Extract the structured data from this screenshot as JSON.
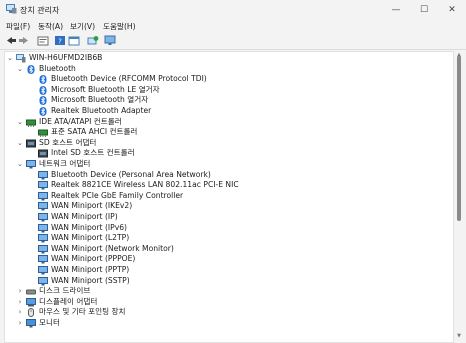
{
  "window": {
    "title": "장치 관리자",
    "minimize": "—",
    "maximize": "☐",
    "close": "✕"
  },
  "menu": [
    "파일(F)",
    "동작(A)",
    "보기(V)",
    "도움말(H)"
  ],
  "toolbar": [
    "back-icon",
    "forward-icon",
    "properties-icon",
    "help-icon",
    "view-icon",
    "scan-icon",
    "monitor-icon"
  ],
  "tree": {
    "root": "WIN-H6UFMD2IB6B",
    "rows": [
      {
        "level": 1,
        "state": "expanded",
        "icon": "bluetooth",
        "label": "Bluetooth"
      },
      {
        "level": 2,
        "state": "leaf",
        "icon": "bluetooth",
        "label": "Bluetooth Device (RFCOMM Protocol TDI)"
      },
      {
        "level": 2,
        "state": "leaf",
        "icon": "bluetooth",
        "label": "Microsoft Bluetooth LE 열거자"
      },
      {
        "level": 2,
        "state": "leaf",
        "icon": "bluetooth",
        "label": "Microsoft Bluetooth 열거자"
      },
      {
        "level": 2,
        "state": "leaf",
        "icon": "bluetooth",
        "label": "Realtek Bluetooth Adapter"
      },
      {
        "level": 1,
        "state": "expanded",
        "icon": "ide",
        "label": "IDE ATA/ATAPI 컨트롤러"
      },
      {
        "level": 2,
        "state": "leaf",
        "icon": "ide",
        "label": "표준 SATA AHCI 컨트롤러"
      },
      {
        "level": 1,
        "state": "expanded",
        "icon": "sd",
        "label": "SD 호스트 어댑터"
      },
      {
        "level": 2,
        "state": "leaf",
        "icon": "sd",
        "label": "Intel SD 호스트 컨트롤러"
      },
      {
        "level": 1,
        "state": "expanded",
        "icon": "network",
        "label": "네트워크 어댑터"
      },
      {
        "level": 2,
        "state": "leaf",
        "icon": "network",
        "label": "Bluetooth Device (Personal Area Network)"
      },
      {
        "level": 2,
        "state": "leaf",
        "icon": "network",
        "label": "Realtek 8821CE Wireless LAN 802.11ac PCI-E NIC"
      },
      {
        "level": 2,
        "state": "leaf",
        "icon": "network",
        "label": "Realtek PCIe GbE Family Controller"
      },
      {
        "level": 2,
        "state": "leaf",
        "icon": "network",
        "label": "WAN Miniport (IKEv2)"
      },
      {
        "level": 2,
        "state": "leaf",
        "icon": "network",
        "label": "WAN Miniport (IP)"
      },
      {
        "level": 2,
        "state": "leaf",
        "icon": "network",
        "label": "WAN Miniport (IPv6)"
      },
      {
        "level": 2,
        "state": "leaf",
        "icon": "network",
        "label": "WAN Miniport (L2TP)"
      },
      {
        "level": 2,
        "state": "leaf",
        "icon": "network",
        "label": "WAN Miniport (Network Monitor)"
      },
      {
        "level": 2,
        "state": "leaf",
        "icon": "network",
        "label": "WAN Miniport (PPPOE)"
      },
      {
        "level": 2,
        "state": "leaf",
        "icon": "network",
        "label": "WAN Miniport (PPTP)"
      },
      {
        "level": 2,
        "state": "leaf",
        "icon": "network",
        "label": "WAN Miniport (SSTP)"
      },
      {
        "level": 1,
        "state": "collapsed",
        "icon": "disk",
        "label": "디스크 드라이브"
      },
      {
        "level": 1,
        "state": "collapsed",
        "icon": "display",
        "label": "디스플레이 어댑터"
      },
      {
        "level": 1,
        "state": "collapsed",
        "icon": "mouse",
        "label": "마우스 및 기타 포인팅 장치"
      },
      {
        "level": 1,
        "state": "collapsed",
        "icon": "monitor",
        "label": "모니터"
      }
    ]
  },
  "colors": {
    "bluetooth": "#1e6fd9",
    "network": "#2b7bd1",
    "accent": "#0078d4"
  }
}
